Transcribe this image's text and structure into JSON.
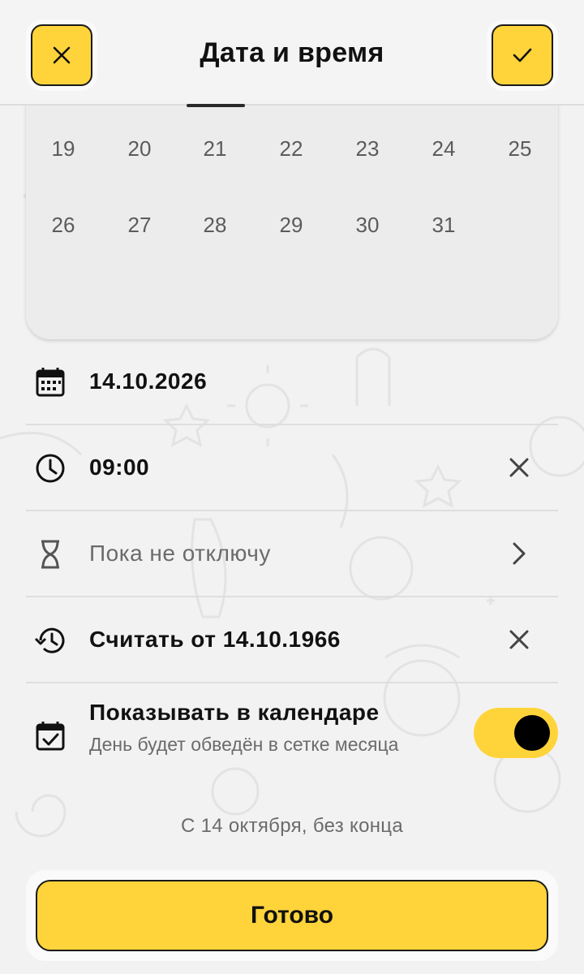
{
  "header": {
    "title": "Дата и время",
    "cancel_icon": "close-icon",
    "confirm_icon": "check-icon"
  },
  "calendar": {
    "week1": [
      "19",
      "20",
      "21",
      "22",
      "23",
      "24",
      "25"
    ],
    "week2": [
      "26",
      "27",
      "28",
      "29",
      "30",
      "31"
    ]
  },
  "rows": {
    "date": {
      "icon": "calendar-icon",
      "value": "14.10.2026"
    },
    "time": {
      "icon": "clock-icon",
      "value": "09:00",
      "action_icon": "close-icon"
    },
    "duration": {
      "icon": "hourglass-icon",
      "value": "Пока не отключу",
      "action_icon": "chevron-right-icon"
    },
    "count_from": {
      "icon": "history-icon",
      "value": "Считать от 14.10.1966",
      "action_icon": "close-icon"
    },
    "show_in_calendar": {
      "icon": "calendar-check-icon",
      "title": "Показывать в календаре",
      "subtitle": "День будет обведён в сетке месяца",
      "enabled": true
    }
  },
  "summary": "С 14 октября, без конца",
  "done_label": "Готово",
  "colors": {
    "accent": "#ffd43b",
    "background": "#f2f2f2",
    "text": "#111111",
    "muted": "#6b6b6b"
  }
}
